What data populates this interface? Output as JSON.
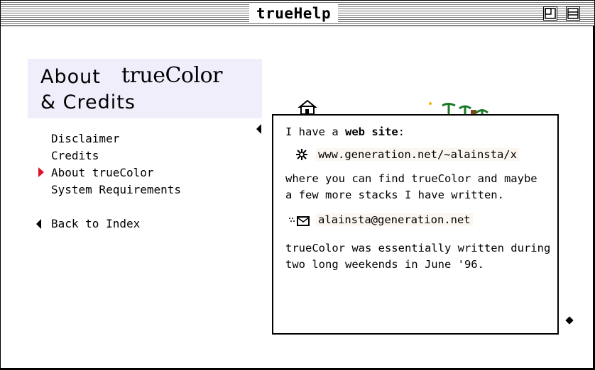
{
  "window": {
    "title": "trueHelp"
  },
  "heading": {
    "line1": "About",
    "brand": "trueColor",
    "line2": "& Credits"
  },
  "nav": {
    "items": [
      {
        "label": "Disclaimer"
      },
      {
        "label": "Credits"
      },
      {
        "label": "About trueColor",
        "current": true
      },
      {
        "label": "System Requirements"
      }
    ],
    "back_label": "Back to Index"
  },
  "card": {
    "line1_prefix": "I have a ",
    "line1_bold": "web site",
    "line1_suffix": ":",
    "website": "www.generation.net/~alainsta/x",
    "para1_line1": "where you can find trueColor and maybe",
    "para1_line2": "a few more stacks I have written.",
    "email": "alainsta@generation.net",
    "para2_line1": "trueColor was essentially written during",
    "para2_line2": "two long weekends in June '96."
  },
  "icons": {
    "zoom": "zoom-box-icon",
    "collapse": "collapse-box-icon",
    "web": "web-spark-icon",
    "mail": "mail-icon",
    "house": "house-icon",
    "trees": "palm-trees-icon",
    "popup": "popup-arrow-icon",
    "marker": "current-item-marker-icon",
    "back": "back-arrow-icon",
    "resize": "diamond-icon"
  },
  "colors": {
    "heading_bg": "#f1eefb",
    "marker": "#e0102a",
    "link_bg": "#fbf6f0",
    "tree": "#1a7a2a"
  }
}
